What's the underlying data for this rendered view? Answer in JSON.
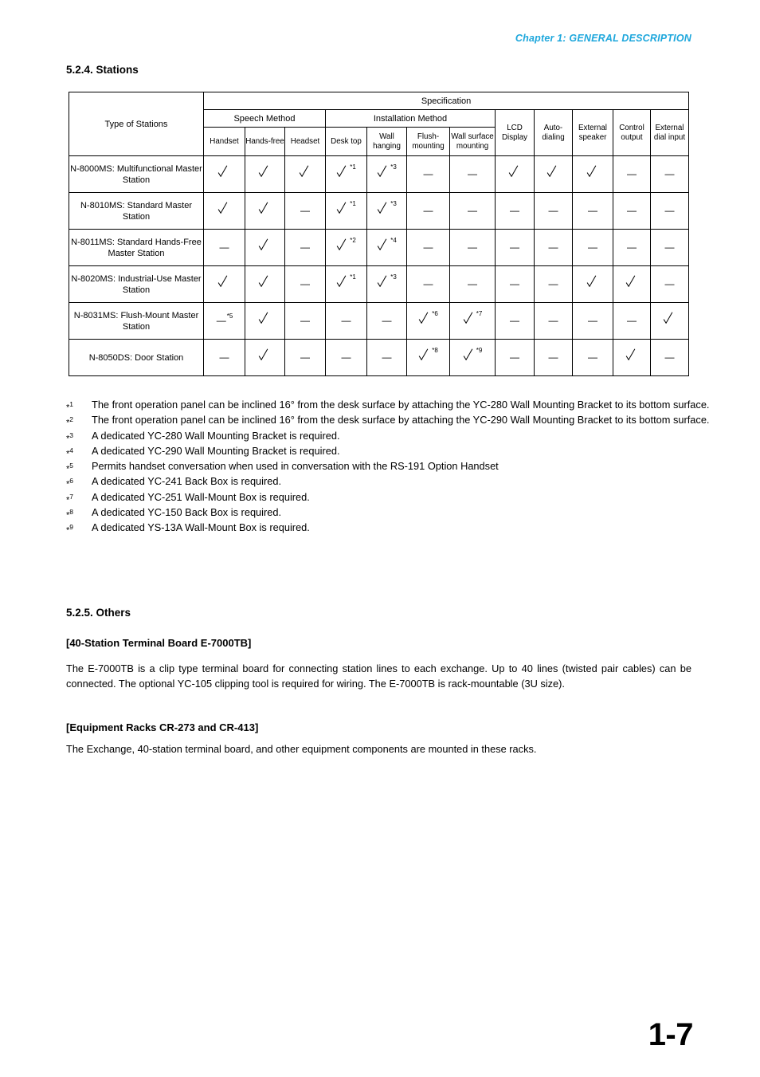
{
  "header": {
    "chapter": "Chapter 1:  GENERAL DESCRIPTION"
  },
  "sections": {
    "stations_title": "5.2.4. Stations",
    "others_title": "5.2.5. Others",
    "sub1_title": "[40-Station Terminal Board E-7000TB]",
    "sub1_text": "The E-7000TB is a clip type terminal board for connecting station lines to each exchange. Up to 40 lines (twisted pair cables) can be connected. The optional YC-105 clipping tool is required for wiring. The E-7000TB is rack-mountable (3U size).",
    "sub2_title": "[Equipment Racks CR-273 and CR-413]",
    "sub2_text": "The Exchange, 40-station terminal board, and other equipment components are mounted in these racks."
  },
  "table": {
    "spec_header": "Specification",
    "type_header": "Type of Stations",
    "group_speech": "Speech Method",
    "group_install": "Installation Method",
    "columns": [
      "Handset",
      "Hands-free",
      "Headset",
      "Desk top",
      "Wall hanging",
      "Flush-mounting",
      "Wall surface mounting",
      "LCD Display",
      "Auto-dialing",
      "External speaker",
      "Control output",
      "External dial input"
    ],
    "rows": [
      {
        "name": "N-8000MS: Multifunctional Master Station",
        "cells": [
          {
            "v": "check"
          },
          {
            "v": "check"
          },
          {
            "v": "check"
          },
          {
            "v": "check",
            "sup": "*1"
          },
          {
            "v": "check",
            "sup": "*3"
          },
          {
            "v": "dash"
          },
          {
            "v": "dash"
          },
          {
            "v": "check"
          },
          {
            "v": "check"
          },
          {
            "v": "check"
          },
          {
            "v": "dash"
          },
          {
            "v": "dash"
          }
        ]
      },
      {
        "name": "N-8010MS: Standard Master Station",
        "cells": [
          {
            "v": "check"
          },
          {
            "v": "check"
          },
          {
            "v": "dash"
          },
          {
            "v": "check",
            "sup": "*1"
          },
          {
            "v": "check",
            "sup": "*3"
          },
          {
            "v": "dash"
          },
          {
            "v": "dash"
          },
          {
            "v": "dash"
          },
          {
            "v": "dash"
          },
          {
            "v": "dash"
          },
          {
            "v": "dash"
          },
          {
            "v": "dash"
          }
        ]
      },
      {
        "name": "N-8011MS: Standard Hands-Free Master Station",
        "cells": [
          {
            "v": "dash"
          },
          {
            "v": "check"
          },
          {
            "v": "dash"
          },
          {
            "v": "check",
            "sup": "*2"
          },
          {
            "v": "check",
            "sup": "*4"
          },
          {
            "v": "dash"
          },
          {
            "v": "dash"
          },
          {
            "v": "dash"
          },
          {
            "v": "dash"
          },
          {
            "v": "dash"
          },
          {
            "v": "dash"
          },
          {
            "v": "dash"
          }
        ]
      },
      {
        "name": "N-8020MS: Industrial-Use Master Station",
        "cells": [
          {
            "v": "check"
          },
          {
            "v": "check"
          },
          {
            "v": "dash"
          },
          {
            "v": "check",
            "sup": "*1"
          },
          {
            "v": "check",
            "sup": "*3"
          },
          {
            "v": "dash"
          },
          {
            "v": "dash"
          },
          {
            "v": "dash"
          },
          {
            "v": "dash"
          },
          {
            "v": "check"
          },
          {
            "v": "check"
          },
          {
            "v": "dash"
          }
        ]
      },
      {
        "name": "N-8031MS: Flush-Mount Master Station",
        "cells": [
          {
            "v": "dash",
            "sup": "*5"
          },
          {
            "v": "check"
          },
          {
            "v": "dash"
          },
          {
            "v": "dash"
          },
          {
            "v": "dash"
          },
          {
            "v": "check",
            "sup": "*6"
          },
          {
            "v": "check",
            "sup": "*7"
          },
          {
            "v": "dash"
          },
          {
            "v": "dash"
          },
          {
            "v": "dash"
          },
          {
            "v": "dash"
          },
          {
            "v": "check"
          }
        ]
      },
      {
        "name": "N-8050DS: Door Station",
        "cells": [
          {
            "v": "dash"
          },
          {
            "v": "check"
          },
          {
            "v": "dash"
          },
          {
            "v": "dash"
          },
          {
            "v": "dash"
          },
          {
            "v": "check",
            "sup": "*8"
          },
          {
            "v": "check",
            "sup": "*9"
          },
          {
            "v": "dash"
          },
          {
            "v": "dash"
          },
          {
            "v": "dash"
          },
          {
            "v": "check"
          },
          {
            "v": "dash"
          }
        ]
      }
    ]
  },
  "footnotes": [
    {
      "id": "*1",
      "text": "The front operation panel can be inclined 16° from the desk surface by attaching the YC-280 Wall Mounting Bracket to its bottom surface."
    },
    {
      "id": "*2",
      "text": "The front operation panel can be inclined 16° from the desk surface by attaching the YC-290 Wall Mounting Bracket to its bottom surface."
    },
    {
      "id": "*3",
      "text": "A dedicated YC-280 Wall Mounting Bracket is required."
    },
    {
      "id": "*4",
      "text": "A dedicated YC-290 Wall Mounting Bracket is required."
    },
    {
      "id": "*5",
      "text": "Permits handset conversation when used in conversation with the RS-191 Option Handset"
    },
    {
      "id": "*6",
      "text": "A dedicated YC-241 Back Box is required."
    },
    {
      "id": "*7",
      "text": "A dedicated YC-251 Wall-Mount Box is required."
    },
    {
      "id": "*8",
      "text": "A dedicated YC-150 Back Box is required."
    },
    {
      "id": "*9",
      "text": "A dedicated YS-13A Wall-Mount Box is required."
    }
  ],
  "page_number": "1-7"
}
